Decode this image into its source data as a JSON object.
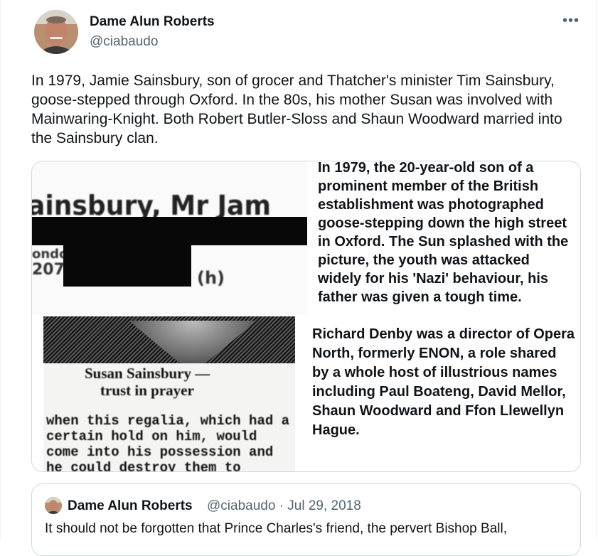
{
  "author": {
    "name": "Dame Alun Roberts",
    "handle": "@ciabaudo"
  },
  "more_label": "•••",
  "tweet": {
    "text": "In 1979, Jamie Sainsbury, son of grocer and Thatcher's minister Tim Sainsbury, goose-stepped through Oxford. In the 80s, his mother Susan was involved with Mainwaring-Knight. Both Robert Butler-Sloss and Shaun Woodward married into the Sainsbury clan."
  },
  "media": {
    "clip1": {
      "heading": "ainsbury, Mr Jam",
      "line2": "ondon",
      "line3": "207",
      "tag": "(h)"
    },
    "text1": "In 1979, the 20-year-old son of a prominent member of the British establishment was photographed goose-stepping down the high street in Oxford. The Sun splashed with the picture, the youth was attacked widely for his 'Nazi' behaviour, his father was given a tough time.",
    "clip2": {
      "headline1": "Susan Sainsbury —",
      "headline2": "trust in prayer",
      "paragraph": "when this regalia, which had a certain hold on him, would come into his possession and he could destroy them to"
    },
    "text2": "Richard Denby was a director of Opera North, formerly ENON, a role shared by a whole host of illustrious names including Paul Boateng, David Mellor, Shaun Woodward and Ffon Llewellyn Hague."
  },
  "quote": {
    "name": "Dame Alun Roberts",
    "handle_date": "@ciabaudo · Jul 29, 2018",
    "text": "It should not be forgotten that Prince Charles's friend, the pervert Bishop Ball,"
  }
}
